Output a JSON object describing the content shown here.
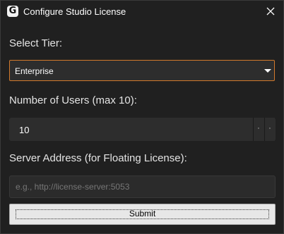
{
  "window": {
    "app_icon_letter": "G",
    "title": "Configure Studio License"
  },
  "tier": {
    "label": "Select Tier:",
    "selected": "Enterprise"
  },
  "users": {
    "label": "Number of Users (max 10):",
    "value": "10",
    "up_glyph": "·",
    "down_glyph": "·"
  },
  "server": {
    "label": "Server Address (for Floating License):",
    "placeholder": "e.g., http://license-server:5053",
    "value": ""
  },
  "submit": {
    "label": "Submit"
  },
  "colors": {
    "accent_focus": "#d1792c",
    "background": "#202020",
    "field": "#2d2d2d"
  }
}
